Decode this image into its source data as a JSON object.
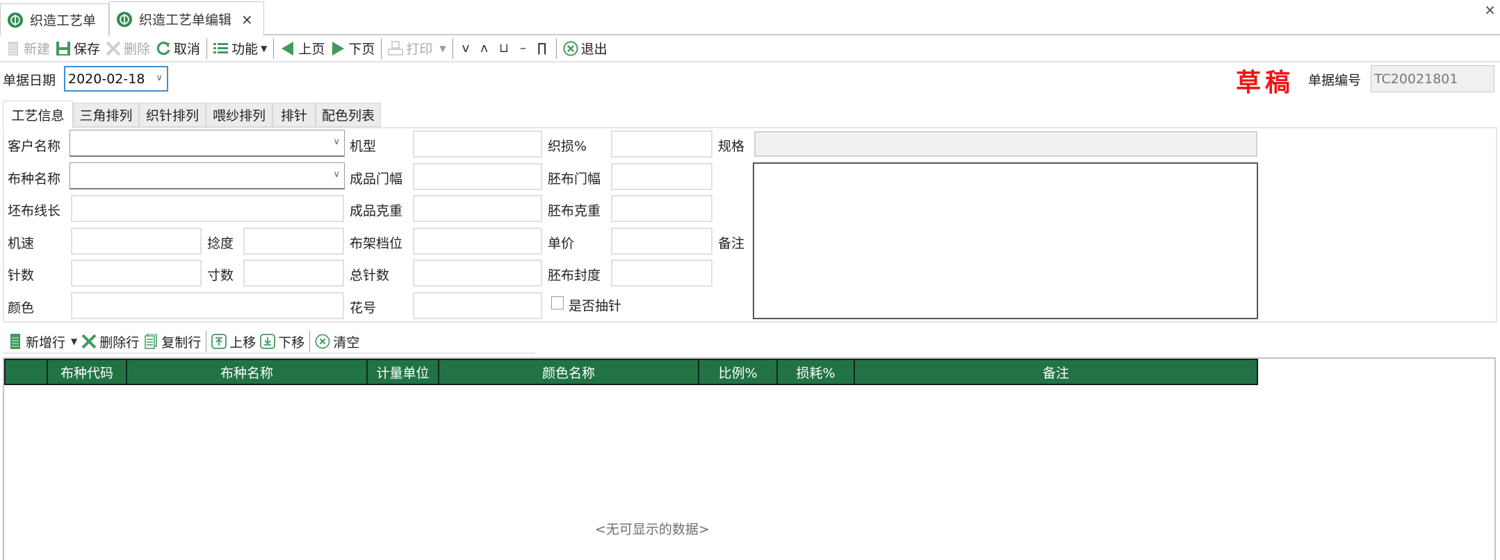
{
  "doc_tabs": [
    {
      "label": "织造工艺单",
      "icon": "globe-icon",
      "active": false
    },
    {
      "label": "织造工艺单编辑",
      "icon": "globe-icon",
      "active": true,
      "closable": true
    }
  ],
  "window": {
    "close_glyph": "×"
  },
  "toolbar": {
    "new": {
      "label": "新建",
      "enabled": false
    },
    "save": {
      "label": "保存",
      "enabled": true
    },
    "delete": {
      "label": "删除",
      "enabled": false
    },
    "cancel": {
      "label": "取消",
      "enabled": true
    },
    "functions": {
      "label": "功能",
      "enabled": true
    },
    "prev_page": {
      "label": "上页",
      "enabled": true
    },
    "next_page": {
      "label": "下页",
      "enabled": true
    },
    "print": {
      "label": "打印",
      "enabled": false
    },
    "mini_buttons": [
      "v",
      "ʌ",
      "⊔",
      "–",
      "∏"
    ],
    "exit": {
      "label": "退出",
      "enabled": true
    }
  },
  "header": {
    "date_label": "单据日期",
    "date_value": "2020-02-18",
    "status_stamp": "草稿",
    "doc_no_label": "单据编号",
    "doc_no_value": "TC20021801"
  },
  "section_tabs": [
    {
      "label": "工艺信息",
      "active": true
    },
    {
      "label": "三角排列",
      "active": false
    },
    {
      "label": "织针排列",
      "active": false
    },
    {
      "label": "喂纱排列",
      "active": false
    },
    {
      "label": "排针",
      "active": false
    },
    {
      "label": "配色列表",
      "active": false
    }
  ],
  "form": {
    "customer_name": {
      "label": "客户名称",
      "value": ""
    },
    "fabric_name": {
      "label": "布种名称",
      "value": ""
    },
    "greige_yarn_length": {
      "label": "坯布线长",
      "value": ""
    },
    "machine_speed": {
      "label": "机速",
      "value": ""
    },
    "twist": {
      "label": "捻度",
      "value": ""
    },
    "needle_count": {
      "label": "针数",
      "value": ""
    },
    "gauge": {
      "label": "寸数",
      "value": ""
    },
    "color": {
      "label": "颜色",
      "value": ""
    },
    "machine_type": {
      "label": "机型",
      "value": ""
    },
    "finished_width": {
      "label": "成品门幅",
      "value": ""
    },
    "finished_weight": {
      "label": "成品克重",
      "value": ""
    },
    "rack_position": {
      "label": "布架档位",
      "value": ""
    },
    "total_needles": {
      "label": "总针数",
      "value": ""
    },
    "pattern_no": {
      "label": "花号",
      "value": ""
    },
    "weaving_loss": {
      "label": "织损%",
      "value": ""
    },
    "greige_width": {
      "label": "胚布门幅",
      "value": ""
    },
    "greige_weight": {
      "label": "胚布克重",
      "value": ""
    },
    "unit_price": {
      "label": "单价",
      "value": ""
    },
    "greige_density": {
      "label": "胚布封度",
      "value": ""
    },
    "needle_draw": {
      "label": "是否抽针",
      "checked": false
    },
    "spec": {
      "label": "规格",
      "value": ""
    },
    "remark": {
      "label": "备注",
      "value": ""
    }
  },
  "grid_toolbar": {
    "add_row": "新增行",
    "delete_row": "删除行",
    "copy_row": "复制行",
    "move_up": "上移",
    "move_down": "下移",
    "clear": "清空"
  },
  "grid": {
    "columns": [
      "",
      "布种代码",
      "布种名称",
      "计量单位",
      "颜色名称",
      "比例%",
      "损耗%",
      "备注"
    ],
    "rows": [],
    "empty_text": "<无可显示的数据>"
  },
  "colors": {
    "grid_header_bg": "#217346",
    "accent_green": "#2f8a4c",
    "stamp_red": "#f01414",
    "focus_blue": "#3c8fd6"
  }
}
